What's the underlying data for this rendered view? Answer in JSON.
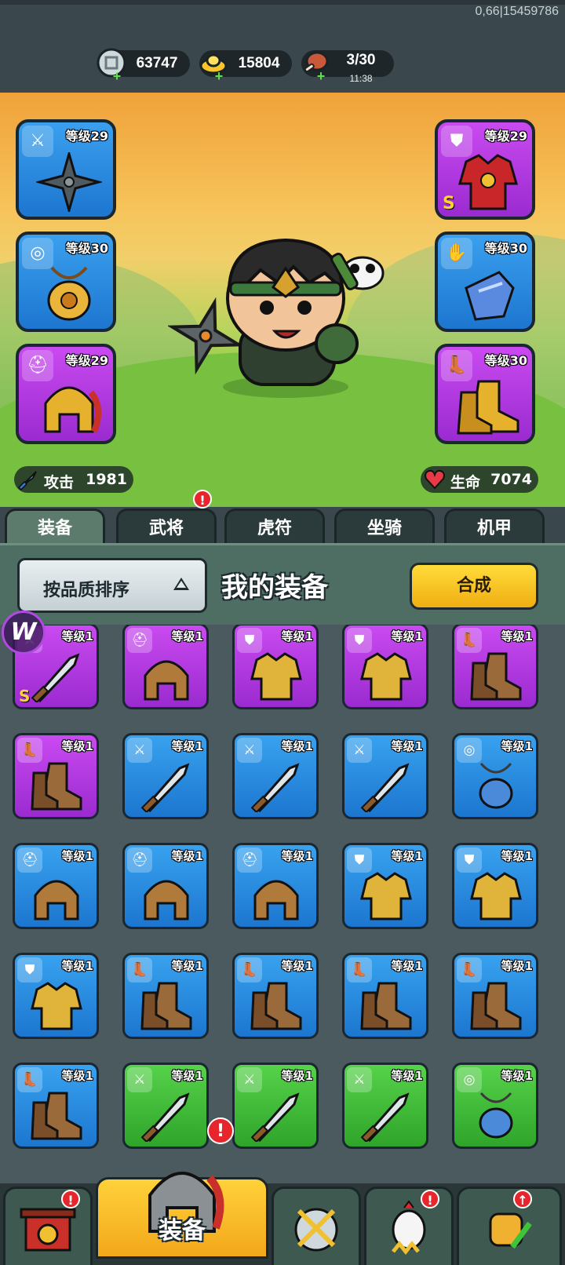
{
  "status": {
    "debug_text": "0,66|15459786"
  },
  "resources": [
    {
      "icon": "silver-coin-icon",
      "value": "63747"
    },
    {
      "icon": "gold-ingot-icon",
      "value": "15804"
    },
    {
      "icon": "meat-stamina-icon",
      "value": "3/30",
      "timer": "11:38"
    }
  ],
  "hero_slots": {
    "left": [
      {
        "type": "weapon-icon",
        "level": "等级29",
        "quality": "blue",
        "item": "shuriken"
      },
      {
        "type": "amulet-icon",
        "level": "等级30",
        "quality": "blue",
        "item": "jade-pendant"
      },
      {
        "type": "helmet-icon",
        "level": "等级29",
        "quality": "purple",
        "item": "gold-helmet"
      }
    ],
    "right": [
      {
        "type": "armor-icon",
        "level": "等级29",
        "quality": "purple",
        "item": "red-armor",
        "grade": "S"
      },
      {
        "type": "gauntlet-icon",
        "level": "等级30",
        "quality": "blue",
        "item": "blue-gauntlet"
      },
      {
        "type": "boots-icon",
        "level": "等级30",
        "quality": "purple",
        "item": "gold-boots"
      }
    ]
  },
  "stats": {
    "attack_label": "攻击",
    "attack_value": "1981",
    "hp_label": "生命",
    "hp_value": "7074"
  },
  "tabs": [
    {
      "label": "装备",
      "active": true
    },
    {
      "label": "武将",
      "badge": "!"
    },
    {
      "label": "虎符"
    },
    {
      "label": "坐骑"
    },
    {
      "label": "机甲"
    }
  ],
  "panel": {
    "sort_label": "按品质排序",
    "title": "我的装备",
    "merge_label": "合成"
  },
  "inventory": [
    {
      "type": "weapon-icon",
      "level": "等级1",
      "quality": "purple",
      "grade": "S",
      "item": "crossed-swords"
    },
    {
      "type": "helmet-icon",
      "level": "等级1",
      "quality": "purple",
      "item": "bronze-helmet"
    },
    {
      "type": "armor-icon",
      "level": "等级1",
      "quality": "purple",
      "item": "gold-armor"
    },
    {
      "type": "armor-icon",
      "level": "等级1",
      "quality": "purple",
      "item": "jeweled-armor"
    },
    {
      "type": "boots-icon",
      "level": "等级1",
      "quality": "purple",
      "item": "blue-boots"
    },
    {
      "type": "boots-icon",
      "level": "等级1",
      "quality": "purple",
      "item": "violet-boots"
    },
    {
      "type": "weapon-icon",
      "level": "等级1",
      "quality": "blue",
      "item": "curved-blade"
    },
    {
      "type": "weapon-icon",
      "level": "等级1",
      "quality": "blue",
      "item": "crossbow"
    },
    {
      "type": "weapon-icon",
      "level": "等级1",
      "quality": "blue",
      "item": "tri-blade"
    },
    {
      "type": "amulet-icon",
      "level": "等级1",
      "quality": "blue",
      "item": "blue-pendant"
    },
    {
      "type": "helmet-icon",
      "level": "等级1",
      "quality": "blue",
      "item": "brown-helmet"
    },
    {
      "type": "helmet-icon",
      "level": "等级1",
      "quality": "blue",
      "item": "crystal-crown"
    },
    {
      "type": "helmet-icon",
      "level": "等级1",
      "quality": "blue",
      "item": "red-helmet"
    },
    {
      "type": "armor-icon",
      "level": "等级1",
      "quality": "blue",
      "item": "blue-robe"
    },
    {
      "type": "armor-icon",
      "level": "等级1",
      "quality": "blue",
      "item": "gold-plate"
    },
    {
      "type": "armor-icon",
      "level": "等级1",
      "quality": "blue",
      "item": "purple-plate"
    },
    {
      "type": "boots-icon",
      "level": "等级1",
      "quality": "blue",
      "item": "leather-boots"
    },
    {
      "type": "boots-icon",
      "level": "等级1",
      "quality": "blue",
      "item": "leather-boots"
    },
    {
      "type": "boots-icon",
      "level": "等级1",
      "quality": "blue",
      "item": "red-boots"
    },
    {
      "type": "boots-icon",
      "level": "等级1",
      "quality": "blue",
      "item": "violet-boots"
    },
    {
      "type": "boots-icon",
      "level": "等级1",
      "quality": "blue",
      "item": "violet-boots"
    },
    {
      "type": "weapon-icon",
      "level": "等级1",
      "quality": "green",
      "item": "curved-blade"
    },
    {
      "type": "weapon-icon",
      "level": "等级1",
      "quality": "green",
      "item": "short-sword"
    },
    {
      "type": "weapon-icon",
      "level": "等级1",
      "quality": "green",
      "item": "broad-blade"
    },
    {
      "type": "amulet-icon",
      "level": "等级1",
      "quality": "green",
      "item": "horn-pendant"
    }
  ],
  "bottom_nav": [
    {
      "icon": "shop-gate-icon",
      "badge": "!"
    },
    {
      "icon": "equipment-helmet-icon",
      "label": "装备",
      "active": true,
      "badge": "!"
    },
    {
      "icon": "battle-shield-icon"
    },
    {
      "icon": "rooster-hero-icon",
      "badge": "!"
    },
    {
      "icon": "upgrade-fist-icon",
      "badge": "↑"
    }
  ],
  "colors": {
    "blue_quality": "#2a8ee0",
    "purple_quality": "#b23ae6",
    "green_quality": "#44bc3a",
    "merge_button": "#f8c622",
    "badge_red": "#e6262c"
  }
}
